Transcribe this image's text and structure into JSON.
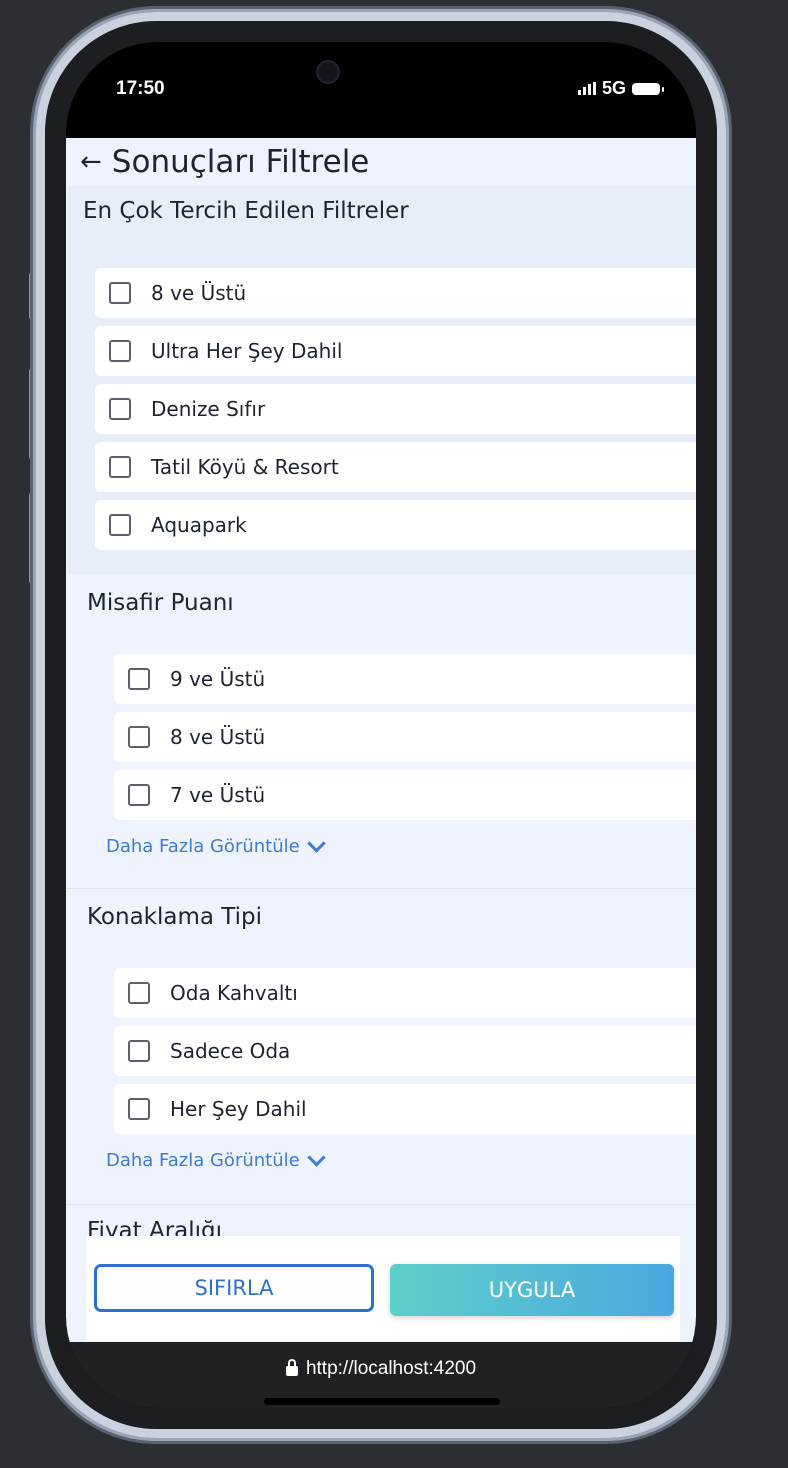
{
  "status_bar": {
    "time": "17:50",
    "network": "5G"
  },
  "header": {
    "back_icon": "arrow-left-icon",
    "title": "Sonuçları Filtrele"
  },
  "popular": {
    "title": "En Çok Tercih Edilen Filtreler",
    "items": [
      {
        "label": "8 ve Üstü"
      },
      {
        "label": "Ultra Her Şey Dahil"
      },
      {
        "label": "Denize Sıfır"
      },
      {
        "label": "Tatil Köyü & Resort"
      },
      {
        "label": "Aquapark"
      }
    ]
  },
  "guest_rating": {
    "title": "Misafir Puanı",
    "items": [
      {
        "label": "9 ve Üstü"
      },
      {
        "label": "8 ve Üstü"
      },
      {
        "label": "7 ve Üstü"
      }
    ],
    "more_label": "Daha Fazla Görüntüle"
  },
  "board_type": {
    "title": "Konaklama Tipi",
    "items": [
      {
        "label": "Oda Kahvaltı"
      },
      {
        "label": "Sadece Oda"
      },
      {
        "label": "Her Şey Dahil"
      }
    ],
    "more_label": "Daha Fazla Görüntüle"
  },
  "price_range": {
    "title": "Fiyat Aralığı"
  },
  "footer": {
    "reset_label": "SIFIRLA",
    "apply_label": "UYGULA"
  },
  "browser": {
    "url": "http://localhost:4200"
  },
  "colors": {
    "accent": "#2e6fd0",
    "link": "#3c7bd6",
    "apply_start": "#5dcfc9",
    "apply_end": "#4aa8e0"
  }
}
